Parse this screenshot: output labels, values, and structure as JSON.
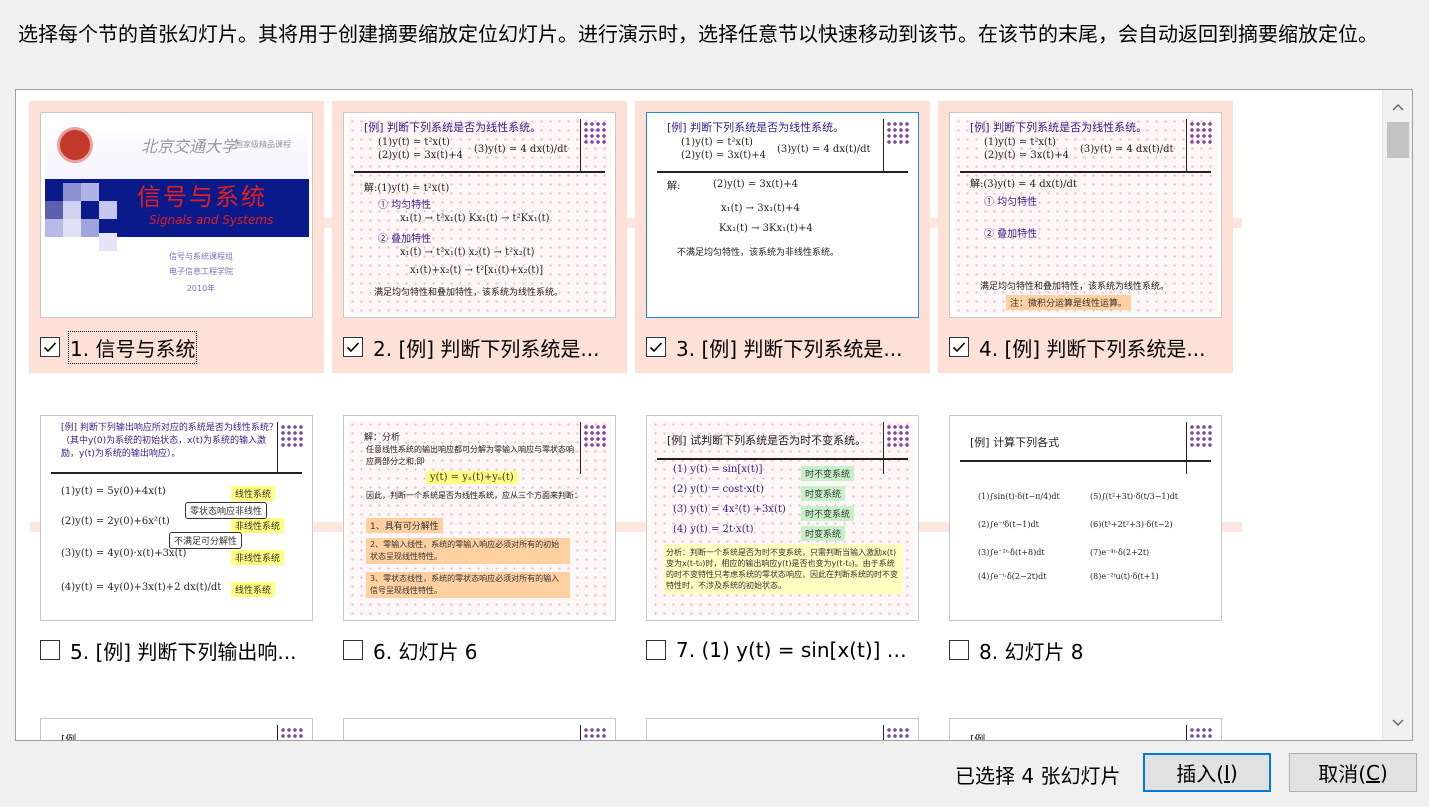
{
  "instruction": "选择每个节的首张幻灯片。其将用于创建摘要缩放定位幻灯片。进行演示时，选择任意节以快速移动到该节。在该节的末尾，会自动返回到摘要缩放定位。",
  "slides": [
    {
      "label": "1. 信号与系统",
      "checked": true
    },
    {
      "label": "2. [例]  判断下列系统是...",
      "checked": true
    },
    {
      "label": "3. [例]  判断下列系统是...",
      "checked": true
    },
    {
      "label": "4. [例]  判断下列系统是...",
      "checked": true
    },
    {
      "label": "5. [例]  判断下列输出响...",
      "checked": false
    },
    {
      "label": "6. 幻灯片 6",
      "checked": false
    },
    {
      "label": "7. (1) y(t) = sin[x(t)]  (2...",
      "checked": false
    },
    {
      "label": "8. 幻灯片 8",
      "checked": false
    }
  ],
  "thumb1": {
    "school": "北京交通大学",
    "course": "国家级精品课程",
    "title_cn": "信号与系统",
    "title_en": "Signals and Systems",
    "dept1": "信号与系统课程组",
    "dept2": "电子信息工程学院",
    "year": "2010年"
  },
  "thumb2": {
    "title": "[例]  判断下列系统是否为线性系统。",
    "l1": "(1)y(t) = t²x(t)",
    "l2": "(2)y(t) = 3x(t)+4",
    "l3": "(3)y(t) = 4 dx(t)/dt",
    "l4": "解:(1)y(t) = t²x(t)",
    "l5": "① 均匀特性",
    "l6": "x₁(t) → t²x₁(t)     Kx₁(t) → t²Kx₁(t)",
    "l7": "② 叠加特性",
    "l8": "x₁(t) → t²x₁(t)     x₂(t) → t²x₂(t)",
    "l9": "x₁(t)+x₂(t) → t²[x₁(t)+x₂(t)]",
    "l10": "满足均匀特性和叠加特性，该系统为线性系统。"
  },
  "thumb3": {
    "title": "[例]  判断下列系统是否为线性系统。",
    "l1": "(1)y(t) = t²x(t)",
    "l2": "(2)y(t) = 3x(t)+4",
    "l3": "(3)y(t) = 4 dx(t)/dt",
    "l4": "解:",
    "l5": "(2)y(t) = 3x(t)+4",
    "l6": "x₁(t) → 3x₁(t)+4",
    "l7": "Kx₁(t) → 3Kx₁(t)+4",
    "l8": "不满足均匀特性，该系统为非线性系统。"
  },
  "thumb4": {
    "title": "[例]  判断下列系统是否为线性系统。",
    "l1": "(1)y(t) = t²x(t)",
    "l2": "(2)y(t) = 3x(t)+4",
    "l3": "(3)y(t) = 4 dx(t)/dt",
    "l4": "解:(3)y(t) = 4 dx(t)/dt",
    "l5": "① 均匀特性",
    "l6": "② 叠加特性",
    "l7": "满足均匀特性和叠加特性，该系统为线性系统。",
    "l8": "注：微积分运算是线性运算。"
  },
  "thumb5": {
    "title": "[例]  判断下列输出响应所对应的系统是否为线性系统？（其中y(0)为系统的初始状态，x(t)为系统的输入激励，y(t)为系统的输出响应）。",
    "l1": "(1)y(t) = 5y(0)+4x(t)",
    "l2": "(2)y(t) = 2y(0)+6x²(t)",
    "l3": "(3)y(t) = 4y(0)·x(t)+3x(t)",
    "l4": "(4)y(t) = 4y(0)+3x(t)+2 dx(t)/dt",
    "t1": "线性系统",
    "t2": "非线性系统",
    "t3": "非线性系统",
    "t4": "线性系统",
    "c1": "零状态响应非线性",
    "c2": "不满足可分解性"
  },
  "thumb6": {
    "l1": "解：分析",
    "l2": "任意线性系统的输出响应都可分解为零输入响应与零状态响应两部分之和,即",
    "l3": "y(t) = yₓ(t)+yₑ(t)",
    "l4": "因此，判断一个系统是否为线性系统，应从三个方面来判断：",
    "t1": "1、具有可分解性",
    "t2": "2、零输入线性，系统的零输入响应必须对所有的初始状态呈现线性特性。",
    "t3": "3、零状态线性，系统的零状态响应必须对所有的输入信号呈现线性特性。"
  },
  "thumb7": {
    "title": "[例]  试判断下列系统是否为时不变系统。",
    "l1": "(1) y(t) = sin[x(t)]",
    "l2": "(2) y(t) = cost·x(t)",
    "l3": "(3) y(t) = 4x²(t) +3x(t)",
    "l4": "(4) y(t) = 2t·x(t)",
    "t1": "时不变系统",
    "t2": "时变系统",
    "t3": "时不变系统",
    "t4": "时变系统",
    "note": "分析：判断一个系统是否为时不变系统，只需判断当输入激励x(t)变为x(t-t₀)时，相应的输出响应y(t)是否也变为y(t-t₀)。由于系统的时不变特性只考虑系统的零状态响应，因此在判断系统的时不变特性时，不涉及系统的初始状态。"
  },
  "thumb8": {
    "title": "[例]  计算下列各式",
    "l1": "(1)∫sin(t)·δ(t−π/4)dt",
    "l2": "(2)∫e⁻ᵗδ(t−1)dt",
    "l3": "(3)∫e⁻²ᵗ·δ(t+8)dt",
    "l4": "(4)∫e⁻ᵗ·δ(2−2t)dt",
    "l5": "(5)∫(t²+3t)·δ(t/3−1)dt",
    "l6": "(6)(t³+2t²+3)·δ(t−2)",
    "l7": "(7)e⁻⁴ᵗ·δ(2+2t)",
    "l8": "(8)e⁻²ᵗu(t)·δ(t+1)"
  },
  "row3_partial": {
    "a": "[例",
    "b": "[例"
  },
  "status": "已选择 4 张幻灯片",
  "buttons": {
    "insert_prefix": "插入(",
    "insert_key": "I",
    "insert_suffix": ")",
    "cancel_prefix": "取消(",
    "cancel_key": "C",
    "cancel_suffix": ")"
  },
  "colors": {
    "selected_bg": "#fde0d6",
    "accent": "#0078d7"
  }
}
